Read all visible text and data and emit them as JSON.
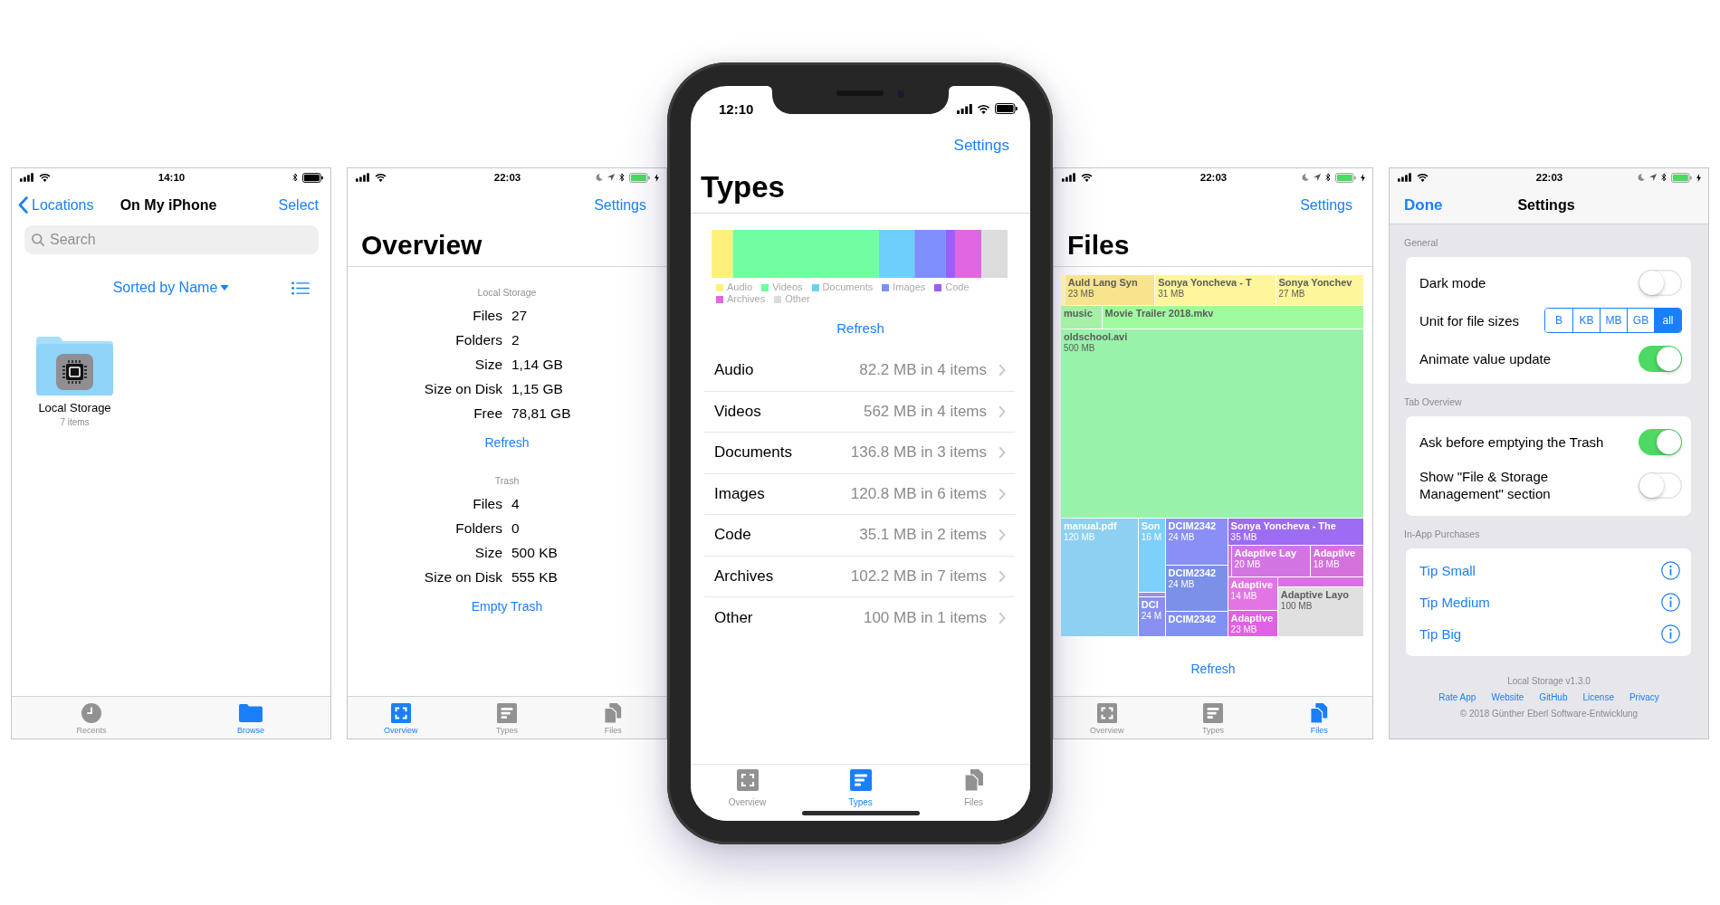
{
  "screens": [
    {
      "kind": "browser",
      "framed": false,
      "status_bar": {
        "time": "14:10",
        "bluetooth": true,
        "do_not_disturb": false,
        "location": false,
        "charging": false
      },
      "nav": {
        "back": "Locations",
        "title": "On My iPhone",
        "action": "Select"
      },
      "search": {
        "placeholder": "Search"
      },
      "sort": {
        "label": "Sorted by Name"
      },
      "items": [
        {
          "name": "Local Storage",
          "detail": "7 items"
        }
      ],
      "tabs": [
        {
          "label": "Recents",
          "selected": false
        },
        {
          "label": "Browse",
          "selected": true
        }
      ]
    },
    {
      "kind": "overview",
      "framed": false,
      "status_bar": {
        "time": "22:03",
        "bluetooth": true,
        "do_not_disturb": true,
        "location": true,
        "charging": true
      },
      "nav": {
        "action": "Settings",
        "large_title": "Overview"
      },
      "sections": [
        {
          "header": "Local Storage",
          "rows": [
            {
              "label": "Files",
              "value": "27"
            },
            {
              "label": "Folders",
              "value": "2"
            },
            {
              "label": "Size",
              "value": "1,14 GB"
            },
            {
              "label": "Size on Disk",
              "value": "1,15 GB"
            },
            {
              "label": "Free",
              "value": "78,81 GB"
            }
          ],
          "action": "Refresh"
        },
        {
          "header": "Trash",
          "rows": [
            {
              "label": "Files",
              "value": "4"
            },
            {
              "label": "Folders",
              "value": "0"
            },
            {
              "label": "Size",
              "value": "500 KB"
            },
            {
              "label": "Size on Disk",
              "value": "555 KB"
            }
          ],
          "action": "Empty Trash"
        }
      ],
      "tabs": [
        {
          "label": "Overview",
          "selected": true
        },
        {
          "label": "Types",
          "selected": false
        },
        {
          "label": "Files",
          "selected": false
        }
      ]
    },
    {
      "kind": "types",
      "framed": true,
      "status_bar": {
        "time": "12:10",
        "bluetooth": false,
        "do_not_disturb": false,
        "location": false,
        "charging": false
      },
      "nav": {
        "action": "Settings",
        "large_title": "Types"
      },
      "legend": [
        {
          "name": "Audio",
          "color": "#fdf17b"
        },
        {
          "name": "Videos",
          "color": "#70fea1"
        },
        {
          "name": "Documents",
          "color": "#6fcffc"
        },
        {
          "name": "Images",
          "color": "#7e8ffb"
        },
        {
          "name": "Code",
          "color": "#995ff9"
        },
        {
          "name": "Archives",
          "color": "#e067e0"
        },
        {
          "name": "Other",
          "color": "#dcdcdc"
        }
      ],
      "refresh": "Refresh",
      "rows": [
        {
          "label": "Audio",
          "value": "82.2 MB in 4 items"
        },
        {
          "label": "Videos",
          "value": "562 MB in 4 items"
        },
        {
          "label": "Documents",
          "value": "136.8 MB in 3 items"
        },
        {
          "label": "Images",
          "value": "120.8 MB in 6 items"
        },
        {
          "label": "Code",
          "value": "35.1 MB in 2 items"
        },
        {
          "label": "Archives",
          "value": "102.2 MB in 7 items"
        },
        {
          "label": "Other",
          "value": "100 MB in 1 items"
        }
      ],
      "tabs": [
        {
          "label": "Overview",
          "selected": false
        },
        {
          "label": "Types",
          "selected": true
        },
        {
          "label": "Files",
          "selected": false
        }
      ]
    },
    {
      "kind": "treemap",
      "framed": false,
      "status_bar": {
        "time": "22:03",
        "bluetooth": true,
        "do_not_disturb": true,
        "location": true,
        "charging": true
      },
      "nav": {
        "action": "Settings",
        "large_title": "Files"
      },
      "tiles": [
        {
          "color": "#fbeea0"
        },
        {
          "name": "Auld Lang Syn",
          "size": "23 MB",
          "color": "#f7e48c"
        },
        {
          "name": "Sonya Yoncheva - T",
          "size": "31 MB",
          "color": "#fef59c"
        },
        {
          "name": "Sonya Yonchev",
          "size": "27 MB",
          "color": "#fef69b"
        },
        {
          "name": "music",
          "color": "#a5efa6"
        },
        {
          "name": "Movie Trailer 2018.mkv",
          "color": "#9efc9e"
        },
        {
          "name": "oldschool.avi",
          "size": "500 MB",
          "color": "#99f2a9"
        },
        {
          "name": "manual.pdf",
          "size": "120 MB",
          "color": "#8dd0f2"
        },
        {
          "name": "Son",
          "size": "16 M",
          "color": "#7ed0fc"
        },
        {
          "color": "#9a8cf0"
        },
        {
          "name": "DCI",
          "size": "24 M",
          "color": "#8a90f1"
        },
        {
          "name": "DCIM2342",
          "size": "24 MB",
          "color": "#898ff6"
        },
        {
          "name": "DCIM2342",
          "size": "24 MB",
          "color": "#7b90e8"
        },
        {
          "name": "DCIM2342",
          "color": "#8191f3"
        },
        {
          "name": "Sonya Yoncheva - The",
          "size": "35 MB",
          "color": "#9c6cf2"
        },
        {
          "color": "#d870e4"
        },
        {
          "name": "Adaptive Lay",
          "size": "20 MB",
          "color": "#d274e2"
        },
        {
          "name": "Adaptive",
          "size": "18 MB",
          "color": "#d472dc"
        },
        {
          "name": "Adaptive",
          "size": "14 MB",
          "color": "#e274e4"
        },
        {
          "color": "#dc6ee6"
        },
        {
          "name": "Adaptive Layo",
          "size": "100 MB",
          "color": "#e0e0e0"
        },
        {
          "name": "Adaptive",
          "size": "23 MB",
          "color": "#e062e3"
        }
      ],
      "refresh": "Refresh",
      "tabs": [
        {
          "label": "Overview",
          "selected": false
        },
        {
          "label": "Types",
          "selected": false
        },
        {
          "label": "Files",
          "selected": true
        }
      ]
    },
    {
      "kind": "settings",
      "framed": false,
      "status_bar": {
        "time": "22:03",
        "bluetooth": true,
        "do_not_disturb": true,
        "location": true,
        "charging": true
      },
      "nav": {
        "done": "Done",
        "title": "Settings"
      },
      "sections": [
        {
          "header": "General",
          "rows": [
            {
              "kind": "toggle",
              "label": "Dark mode",
              "on": false
            },
            {
              "kind": "segmented",
              "label": "Unit for file sizes",
              "options": [
                {
                  "label": "B",
                  "selected": false
                },
                {
                  "label": "KB",
                  "selected": false
                },
                {
                  "label": "MB",
                  "selected": false
                },
                {
                  "label": "GB",
                  "selected": false
                },
                {
                  "label": "all",
                  "selected": true
                }
              ]
            },
            {
              "kind": "toggle",
              "label": "Animate value update",
              "on": true
            }
          ]
        },
        {
          "header": "Tab Overview",
          "rows": [
            {
              "kind": "toggle",
              "label": "Ask before emptying the Trash",
              "on": true
            },
            {
              "kind": "toggle",
              "label": "Show \"File & Storage Management\" section",
              "on": false
            }
          ]
        },
        {
          "header": "In-App Purchases",
          "rows": [
            {
              "kind": "link",
              "label": "Tip Small"
            },
            {
              "kind": "link",
              "label": "Tip Medium"
            },
            {
              "kind": "link",
              "label": "Tip Big"
            }
          ]
        }
      ],
      "footer": {
        "version": "Local Storage v1.3.0",
        "links": [
          "Rate App",
          "Website",
          "GitHub",
          "License",
          "Privacy"
        ],
        "copyright": "© 2018 Günther Eberl Software-Entwicklung"
      }
    }
  ]
}
